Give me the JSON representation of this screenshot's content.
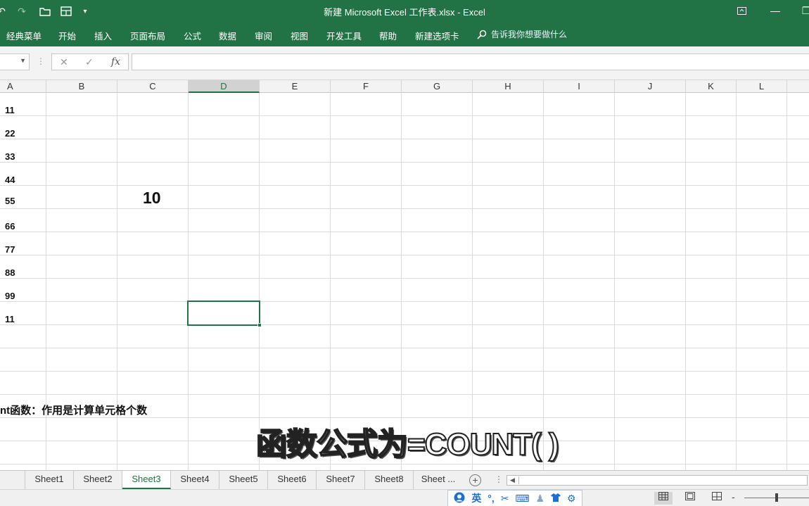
{
  "window": {
    "title": "新建 Microsoft Excel 工作表.xlsx  -  Excel",
    "qa_icons": [
      "undo-icon",
      "redo-icon",
      "open-folder-icon",
      "print-preview-icon",
      "customize-dropdown-icon"
    ],
    "restore_ribbon_icon": "ribbon-display-icon",
    "minimize_symbol": "—",
    "restore_symbol": "❐"
  },
  "menu": {
    "items": [
      "经典菜单",
      "开始",
      "插入",
      "页面布局",
      "公式",
      "数据",
      "审阅",
      "视图",
      "开发工具",
      "帮助",
      "新建选项卡"
    ],
    "tellme": "告诉我你想要做什么"
  },
  "formula_bar": {
    "name_box": "",
    "cancel_symbol": "✕",
    "enter_symbol": "✓",
    "fx_symbol": "fx",
    "formula": ""
  },
  "columns": [
    "A",
    "B",
    "C",
    "D",
    "E",
    "F",
    "G",
    "H",
    "I",
    "J",
    "K",
    "L"
  ],
  "selected_column": "D",
  "cells": {
    "column_a": [
      "11",
      "22",
      "33",
      "44",
      "55",
      "66",
      "77",
      "88",
      "99",
      "11"
    ],
    "c5": "10",
    "note": "nt函数：作用是计算单元格个数"
  },
  "subtitle": "函数公式为=COUNT( )",
  "sheets": [
    "Sheet1",
    "Sheet2",
    "Sheet3",
    "Sheet4",
    "Sheet5",
    "Sheet6",
    "Sheet7",
    "Sheet8",
    "Sheet ..."
  ],
  "active_sheet": "Sheet3",
  "ime": {
    "lang": "英",
    "icons": [
      "ime-logo-icon",
      "ime-lang-label",
      "punctuation-icon",
      "scissors-icon",
      "keyboard-icon",
      "user-icon",
      "skin-icon",
      "settings-icon"
    ]
  },
  "status": {
    "views": [
      "normal-view-icon",
      "page-layout-view-icon",
      "page-break-view-icon"
    ],
    "zoom_minus": "-"
  },
  "colors": {
    "excel_green": "#217346",
    "grid_line": "#dcdcdc",
    "ime_blue": "#1d6fd6"
  }
}
